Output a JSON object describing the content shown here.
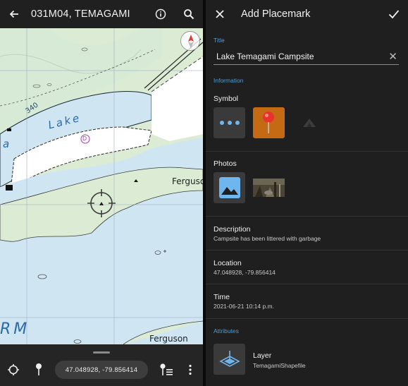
{
  "map": {
    "title": "031M04, TEMAGAMI",
    "labels": {
      "contour": "340",
      "lake": "Lake",
      "lake_partial": "a",
      "ferguson_top": "Ferguso",
      "ferguson_bottom": "Ferguson",
      "rm": "RM",
      "d_marker": "D"
    },
    "icons": {
      "back": "arrow-left-icon",
      "info": "info-icon",
      "search": "search-icon",
      "compass": "compass-icon"
    },
    "colors": {
      "water": "#cfe6f2",
      "land": "#dcecd4",
      "compass_red": "#e03a3a"
    }
  },
  "bottom_bar": {
    "coordinates": "47.048928, -79.856414",
    "icons": [
      "crosshair-icon",
      "pin-icon",
      "pin-list-icon",
      "more-vert-icon"
    ]
  },
  "form": {
    "header": {
      "close_icon": "close-icon",
      "title": "Add Placemark",
      "confirm_icon": "check-icon"
    },
    "title_section": {
      "label": "Title",
      "value": "Lake Temagami Campsite"
    },
    "information_label": "Information",
    "symbol": {
      "label": "Symbol",
      "options": [
        "more-icon",
        "map-pin-icon",
        "tent-icon"
      ],
      "selected_color": "#c46a14"
    },
    "photos": {
      "label": "Photos",
      "add_icon": "image-icon"
    },
    "description": {
      "label": "Description",
      "value": "Campsite has been littered with garbage"
    },
    "location": {
      "label": "Location",
      "value": "47.048928, -79.856414"
    },
    "time": {
      "label": "Time",
      "value": "2021-06-21 10:14 p.m."
    },
    "attributes_label": "Attributes",
    "layer": {
      "label": "Layer",
      "value": "TemagamiShapefile",
      "icon": "layer-icon"
    },
    "accent_color": "#4a9fd8"
  }
}
